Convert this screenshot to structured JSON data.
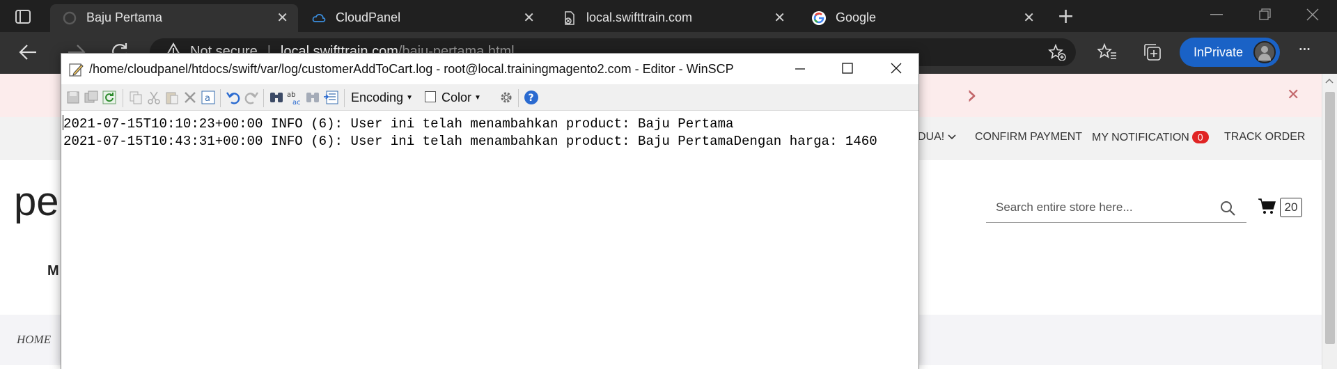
{
  "browser": {
    "tabs": [
      {
        "title": "Baju Pertama",
        "icon": "loading-spinner-icon",
        "active": true
      },
      {
        "title": "CloudPanel",
        "icon": "cloud-icon",
        "active": false
      },
      {
        "title": "local.swifttrain.com",
        "icon": "page-error-icon",
        "active": false
      },
      {
        "title": "Google",
        "icon": "google-icon",
        "active": false
      }
    ],
    "close_glyph": "✕",
    "new_tab_glyph": "+",
    "address": {
      "warning": "Not secure",
      "separator": "|",
      "host": "local.swifttrain.com",
      "path": "/baju-pertama.html"
    },
    "inprivate_label": "InPrivate",
    "menu_glyph": "···",
    "colors": {
      "tabbar": "#202020",
      "toolbar": "#323232",
      "inprivate": "#1a62c6"
    }
  },
  "page": {
    "promo_arrow": "›",
    "promo_close": "✕",
    "topnav": {
      "partial_item": "DUA!",
      "items": [
        "CONFIRM PAYMENT",
        "MY NOTIFICATION",
        "TRACK ORDER"
      ],
      "notification_count": "0"
    },
    "logo_text": "pe",
    "search_placeholder": "Search entire store here...",
    "cart_count": "20",
    "menu_partial": "M",
    "breadcrumb_home": "HOME"
  },
  "editor": {
    "title": "/home/cloudpanel/htdocs/swift/var/log/customerAddToCart.log - root@local.trainingmagento2.com - Editor - WinSCP",
    "toolbar": {
      "encoding_label": "Encoding",
      "color_label": "Color"
    },
    "lines": [
      "2021-07-15T10:10:23+00:00 INFO (6): User ini telah menambahkan product: Baju Pertama",
      "2021-07-15T10:43:31+00:00 INFO (6): User ini telah menambahkan product: Baju PertamaDengan harga: 1460"
    ]
  }
}
